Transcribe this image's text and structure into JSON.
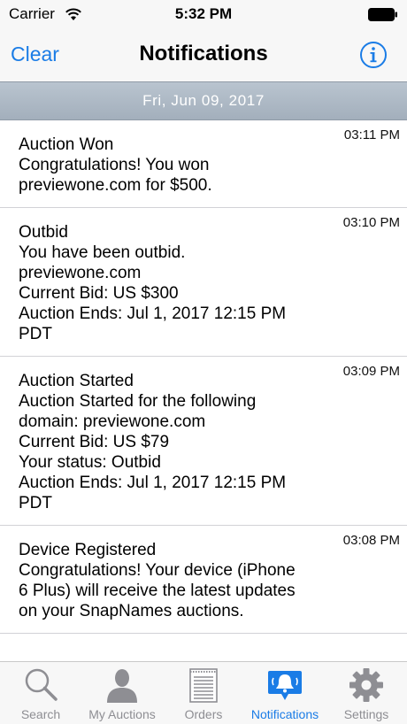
{
  "status_bar": {
    "carrier": "Carrier",
    "time": "5:32 PM",
    "wifi_icon": "wifi-icon",
    "battery_icon": "battery-icon"
  },
  "nav": {
    "left_button": "Clear",
    "title": "Notifications",
    "right_icon": "info-icon"
  },
  "date_header": "Fri, Jun 09, 2017",
  "notifications": [
    {
      "time": "03:11 PM",
      "title": "Auction Won",
      "body": "Congratulations!  You won\npreviewone.com for $500."
    },
    {
      "time": "03:10 PM",
      "title": "Outbid",
      "body": "You have been outbid.\npreviewone.com\nCurrent Bid: US $300\nAuction Ends: Jul 1, 2017 12:15 PM\nPDT"
    },
    {
      "time": "03:09 PM",
      "title": "Auction Started",
      "body": "Auction Started for the following\ndomain: previewone.com\nCurrent Bid: US $79\nYour status: Outbid\nAuction Ends: Jul 1, 2017 12:15 PM\nPDT"
    },
    {
      "time": "03:08 PM",
      "title": "Device Registered",
      "body": "Congratulations! Your device (iPhone\n6 Plus) will receive the latest updates\non your SnapNames auctions."
    }
  ],
  "tabs": [
    {
      "label": "Search",
      "icon": "magnifier-icon",
      "active": false
    },
    {
      "label": "My Auctions",
      "icon": "person-icon",
      "active": false
    },
    {
      "label": "Orders",
      "icon": "document-icon",
      "active": false
    },
    {
      "label": "Notifications",
      "icon": "bell-chat-icon",
      "active": true
    },
    {
      "label": "Settings",
      "icon": "gear-icon",
      "active": false
    }
  ],
  "colors": {
    "accent": "#1a7ce6",
    "tab_inactive": "#8e8e93",
    "date_header_bg": "#aeb9c5"
  }
}
